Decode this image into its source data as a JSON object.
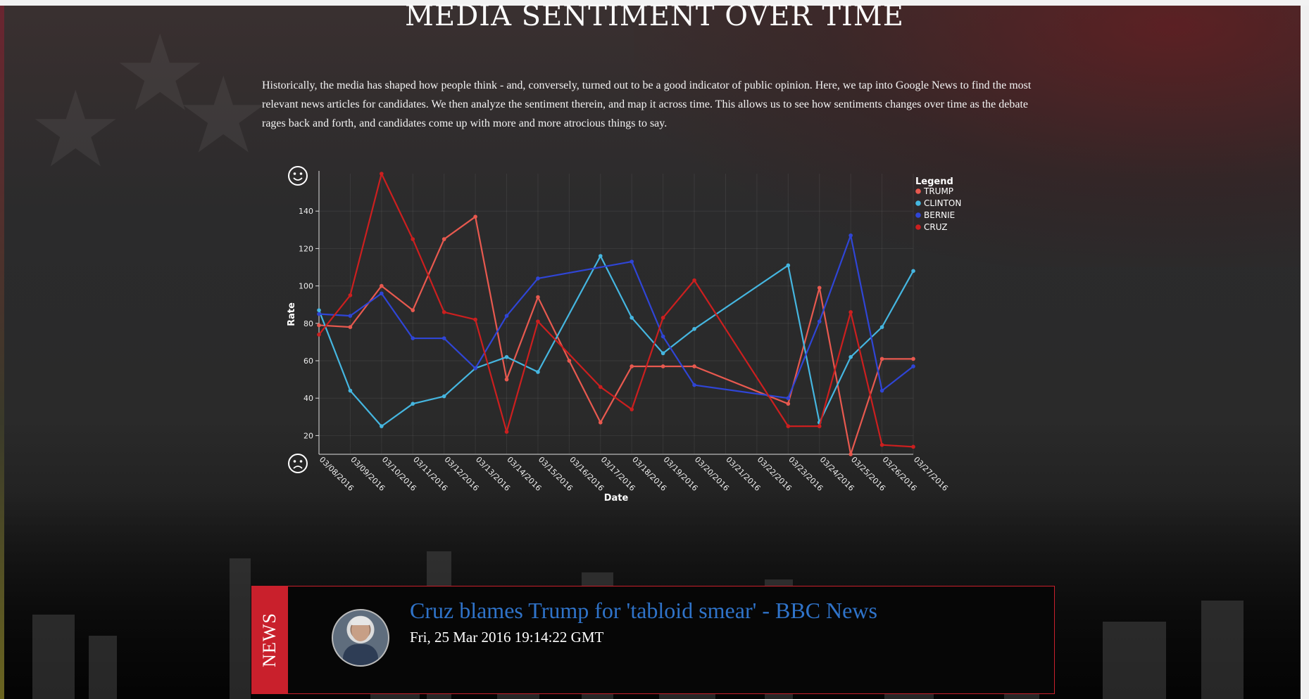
{
  "page": {
    "title": "MEDIA SENTIMENT OVER TIME",
    "intro": "Historically, the media has shaped how people think - and, conversely, turned out to be a good indicator of public opinion. Here, we tap into Google News to find the most relevant news articles for candidates. We then analyze the sentiment therein, and map it across time. This allows us to see how sentiments changes over time as the debate rages back and forth, and candidates come up with more and more atrocious things to say."
  },
  "chart_data": {
    "type": "line",
    "xlabel": "Date",
    "ylabel": "Rate",
    "ylim": [
      10,
      160
    ],
    "yticks": [
      20,
      40,
      60,
      80,
      100,
      120,
      140
    ],
    "grid": true,
    "legend_title": "Legend",
    "legend_position": "top-right",
    "top_icon": "smiley-face-icon",
    "bottom_icon": "sad-face-icon",
    "x": [
      "03/08/2016",
      "03/09/2016",
      "03/10/2016",
      "03/11/2016",
      "03/12/2016",
      "03/13/2016",
      "03/14/2016",
      "03/15/2016",
      "03/16/2016",
      "03/17/2016",
      "03/18/2016",
      "03/19/2016",
      "03/20/2016",
      "03/21/2016",
      "03/22/2016",
      "03/23/2016",
      "03/24/2016",
      "03/25/2016",
      "03/26/2016",
      "03/27/2016"
    ],
    "series": [
      {
        "name": "TRUMP",
        "color": "#e8594f",
        "values": [
          79,
          78,
          100,
          87,
          125,
          137,
          50,
          94,
          60,
          27,
          57,
          57,
          57,
          null,
          null,
          37,
          99,
          10,
          61,
          61
        ]
      },
      {
        "name": "CLINTON",
        "color": "#45b6e0",
        "values": [
          87,
          44,
          25,
          37,
          41,
          56,
          62,
          54,
          null,
          116,
          83,
          64,
          77,
          null,
          null,
          111,
          27,
          62,
          78,
          108
        ]
      },
      {
        "name": "BERNIE",
        "color": "#2f45d6",
        "values": [
          85,
          84,
          96,
          72,
          72,
          56,
          84,
          104,
          null,
          null,
          113,
          73,
          47,
          null,
          null,
          40,
          81,
          127,
          44,
          57
        ]
      },
      {
        "name": "CRUZ",
        "color": "#cc1f1f",
        "values": [
          74,
          95,
          160,
          125,
          86,
          82,
          22,
          81,
          null,
          46,
          34,
          83,
          103,
          null,
          null,
          25,
          25,
          86,
          15,
          14
        ]
      }
    ]
  },
  "news": {
    "tab_label": "NEWS",
    "headline": "Cruz blames Trump for 'tabloid smear' - BBC News",
    "date": "Fri, 25 Mar 2016 19:14:22 GMT"
  }
}
